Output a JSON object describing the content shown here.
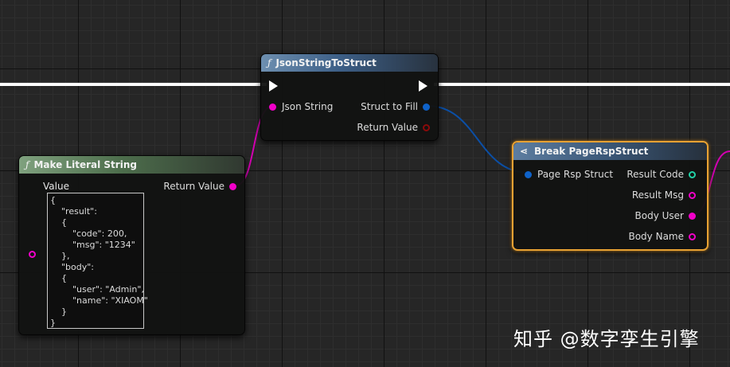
{
  "nodes": {
    "json_to_struct": {
      "title": "JsonStringToStruct",
      "inputs": {
        "json_string": "Json String"
      },
      "outputs": {
        "struct_to_fill": "Struct to Fill",
        "return_value": "Return Value"
      }
    },
    "make_literal": {
      "title": "Make Literal String",
      "value_label": "Value",
      "return_label": "Return Value",
      "value_lines": [
        "{",
        "    \"result\":",
        "    {",
        "        \"code\": 200,",
        "        \"msg\": \"1234\"",
        "    },",
        "    \"body\":",
        "    {",
        "        \"user\": \"Admin\",",
        "        \"name\": \"XIAOM\"",
        "    }",
        "}"
      ]
    },
    "break_struct": {
      "title": "Break PageRspStruct",
      "input": "Page Rsp Struct",
      "outputs": [
        "Result Code",
        "Result Msg",
        "Body User",
        "Body Name"
      ]
    }
  },
  "icons": {
    "function": "function-icon",
    "break": "break-struct-icon",
    "exec": "exec-pin-icon"
  },
  "colors": {
    "exec_wire": "#ffffff",
    "string_pin": "#f200c9",
    "struct_pin": "#0f62c8",
    "json_return_pin": "#8b0a0a",
    "int_pin": "#22d1a6",
    "selected_border": "#e8a233"
  },
  "watermark": "知乎 @数字孪生引擎"
}
